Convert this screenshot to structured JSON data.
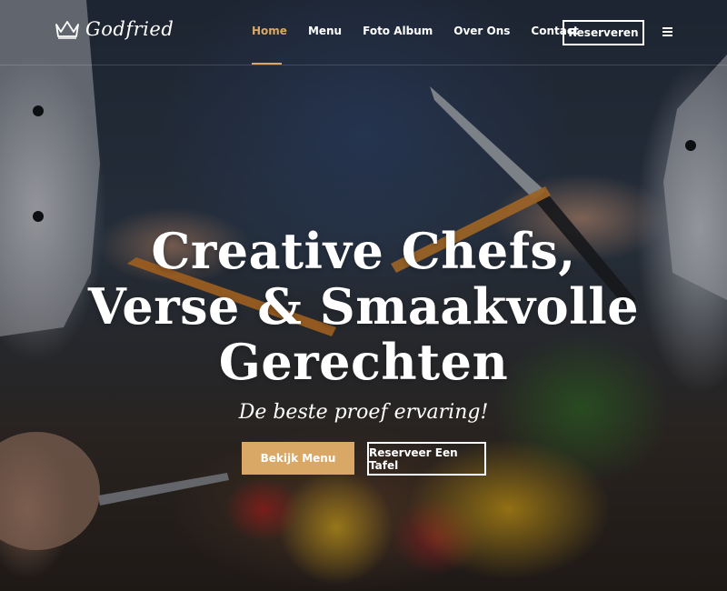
{
  "brand": {
    "name": "Godfried",
    "logo_icon": "crown-icon",
    "accent_color": "#d9a867"
  },
  "nav": {
    "items": [
      {
        "label": "Home",
        "active": true
      },
      {
        "label": "Menu",
        "active": false
      },
      {
        "label": "Foto Album",
        "active": false
      },
      {
        "label": "Over Ons",
        "active": false
      },
      {
        "label": "Contact",
        "active": false
      }
    ],
    "reserve_label": "Reserveren",
    "menu_icon": "hamburger-menu-icon"
  },
  "hero": {
    "title_lines": [
      "Creative Chefs,",
      "Verse & Smaakvolle",
      "Gerechten"
    ],
    "tagline": "De beste proef ervaring!",
    "primary_button": "Bekijk Menu",
    "secondary_button": "Reserveer Een Tafel"
  }
}
